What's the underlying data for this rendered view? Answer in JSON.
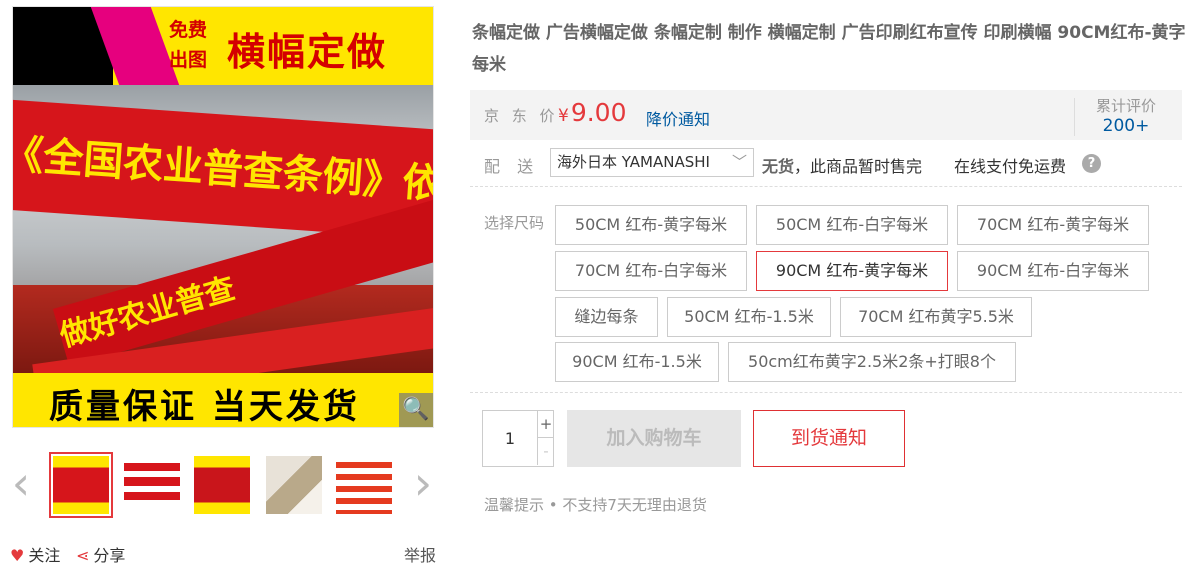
{
  "product": {
    "title": "条幅定做 广告横幅定做 条幅定制 制作 横幅定制 广告印刷红布宣传 印刷横幅 90CM红布-黄字每米",
    "image": {
      "promo_free": "免费出图",
      "promo_main": "横幅定做",
      "banner_text_1": "《全国农业普查条例》依法",
      "banner_text_2": "做好农业普查",
      "slogan": "质量保证 当天发货"
    },
    "thumbnails": [
      "thumb-1",
      "thumb-2",
      "thumb-3",
      "thumb-4",
      "thumb-5"
    ]
  },
  "actions": {
    "follow": "关注",
    "share": "分享",
    "report": "举报"
  },
  "price": {
    "label": "京 东 价",
    "currency": "¥",
    "value": "9.00",
    "notify_link": "降价通知"
  },
  "reviews": {
    "label": "累计评价",
    "count": "200+"
  },
  "shipping": {
    "label": "配 送 至",
    "region": "海外日本 YAMANASHI",
    "stock_status": "无货",
    "stock_note": "，此商品暂时售完",
    "freight": "在线支付免运费"
  },
  "sizes": {
    "label": "选择尺码",
    "options": [
      "50CM 红布-黄字每米",
      "50CM 红布-白字每米",
      "70CM 红布-黄字每米",
      "70CM 红布-白字每米",
      "90CM 红布-黄字每米",
      "90CM 红布-白字每米",
      "缝边每条",
      "50CM 红布-1.5米",
      "70CM 红布黄字5.5米",
      "90CM 红布-1.5米",
      "50cm红布黄字2.5米2条+打眼8个"
    ],
    "selected": "90CM 红布-黄字每米"
  },
  "purchase": {
    "quantity": "1",
    "add_to_cart": "加入购物车",
    "arrival_notice": "到货通知"
  },
  "tip": "温馨提示 • 不支持7天无理由退货",
  "colors": {
    "accent": "#e4393c",
    "link": "#005aa0",
    "price_bg": "#f3f3f3"
  }
}
